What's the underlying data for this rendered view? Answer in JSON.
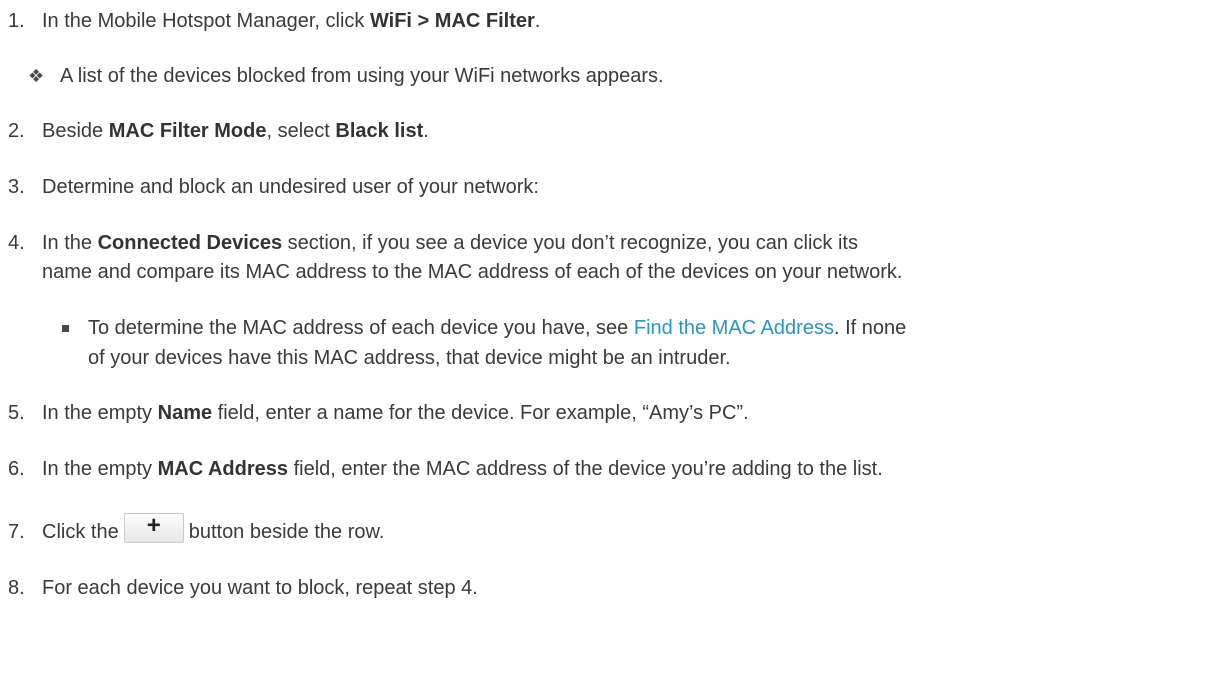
{
  "steps": [
    {
      "num": "1.",
      "parts": [
        "In the Mobile Hotspot Manager, click ",
        "WiFi > MAC Filter",
        "."
      ],
      "sub": {
        "bullet": "❖",
        "text": "A list of the devices blocked from using your WiFi networks appears."
      }
    },
    {
      "num": "2.",
      "parts": [
        "Beside ",
        "MAC Filter Mode",
        ", select ",
        "Black list",
        "."
      ]
    },
    {
      "num": "3.",
      "text": "Determine and block an undesired user of your network:"
    },
    {
      "num": "4.",
      "parts": [
        "In the ",
        "Connected Devices",
        " section, if you see a device you don’t recognize, you can click its"
      ],
      "line2": "name and compare its MAC address to the MAC address of each of the devices on your network.",
      "sub": {
        "line1_pre": "To determine the MAC address of each device you have, see ",
        "link": "Find the MAC Address",
        "line1_post": ". If none",
        "line2": "of your devices have this MAC address, that device might be an intruder."
      }
    },
    {
      "num": "5.",
      "parts": [
        "In the empty ",
        "Name",
        " field, enter a name for the device. For example, “Amy’s PC”."
      ]
    },
    {
      "num": "6.",
      "parts": [
        "In the empty ",
        "MAC Address",
        " field, enter the MAC address of the device you’re adding to the list."
      ]
    },
    {
      "num": "7.",
      "pre": "Click the",
      "button_label": "+",
      "post": "button  beside the row."
    },
    {
      "num": "8.",
      "text": "For each device you want to block, repeat step 4."
    }
  ],
  "colors": {
    "text": "#3a3a3a",
    "link": "#2a93c9"
  }
}
